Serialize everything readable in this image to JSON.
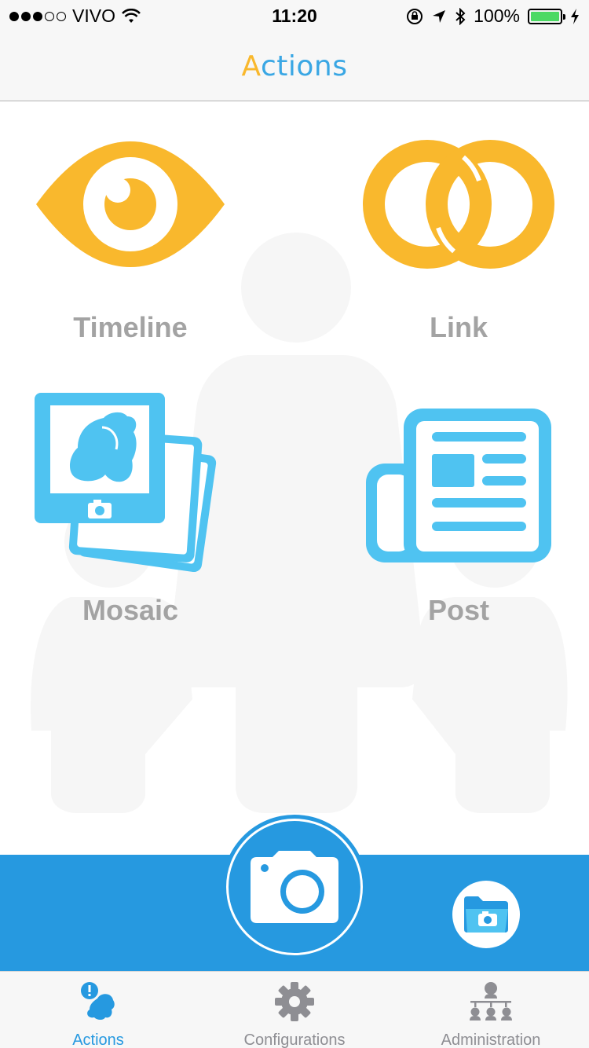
{
  "status_bar": {
    "carrier": "VIVO",
    "time": "11:20",
    "battery_percent": "100%",
    "signal_strength": 3,
    "signal_max": 5
  },
  "nav": {
    "title_first": "A",
    "title_rest": "ctions"
  },
  "actions": {
    "timeline": {
      "label": "Timeline",
      "icon": "eye-icon"
    },
    "link": {
      "label": "Link",
      "icon": "linked-rings-icon"
    },
    "mosaic": {
      "label": "Mosaic",
      "icon": "photo-stack-icon"
    },
    "post": {
      "label": "Post",
      "icon": "newspaper-icon"
    }
  },
  "action_bar": {
    "camera_icon": "camera-icon",
    "gallery_icon": "folder-camera-icon"
  },
  "tabs": [
    {
      "label": "Actions",
      "icon": "child-alert-icon",
      "active": true
    },
    {
      "label": "Configurations",
      "icon": "gear-icon",
      "active": false
    },
    {
      "label": "Administration",
      "icon": "hierarchy-icon",
      "active": false
    }
  ],
  "colors": {
    "accent_blue": "#2699e0",
    "icon_orange": "#f9b82d",
    "icon_light_blue": "#4fc3f1",
    "label_gray": "#a3a3a3",
    "silhouette_gray": "#f5f5f5"
  }
}
